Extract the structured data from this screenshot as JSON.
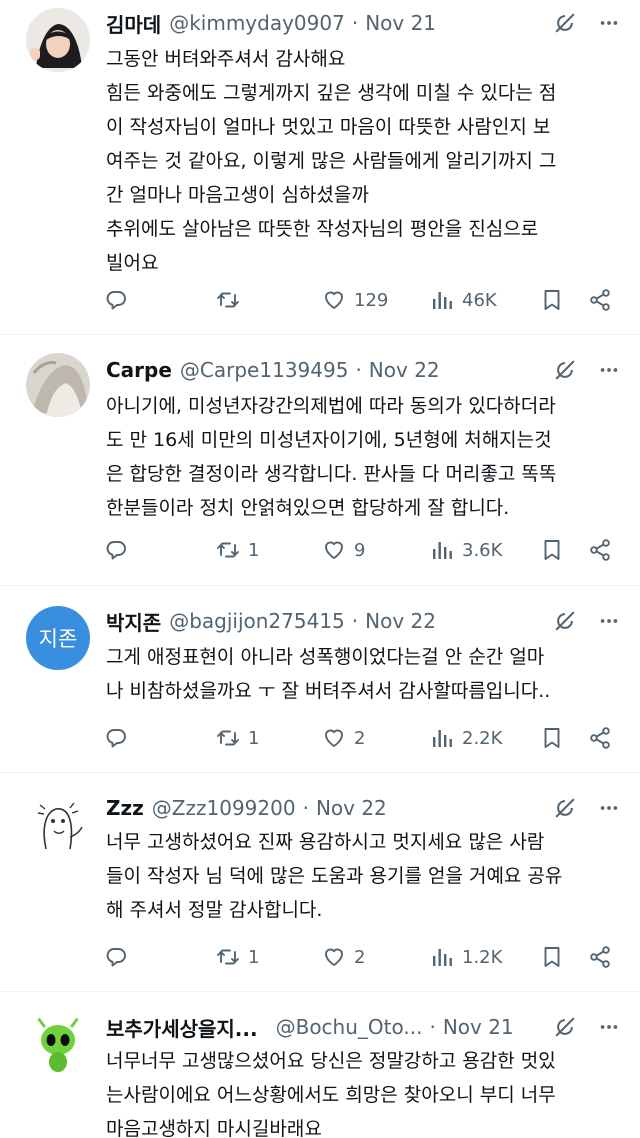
{
  "tweets": [
    {
      "name": "김마데",
      "handle": "@kimmyday0907",
      "date": "Nov 21",
      "lines": [
        "그동안 버텨와주셔서 감사해요",
        "힘든 와중에도 그렇게까지 깊은 생각에 미칠 수 있다는 점",
        "이 작성자님이 얼마나 멋있고 마음이 따뜻한 사람인지 보",
        "여주는 것 같아요, 이렇게 많은 사람들에게 알리기까지 그",
        "간 얼마나 마음고생이 심하셨을까",
        "추위에도 살아남은 따뜻한 작성자님의 평안을 진심으로",
        "빌어요"
      ],
      "replies": "",
      "retweets": "",
      "likes": "129",
      "views": "46K"
    },
    {
      "name": "Carpe",
      "handle": "@Carpe1139495",
      "date": "Nov 22",
      "lines": [
        "아니기에, 미성년자강간의제법에 따라 동의가 있다하더라",
        "도 만 16세 미만의 미성년자이기에, 5년형에 처해지는것",
        "은 합당한 결정이라 생각합니다. 판사들 다 머리좋고 똑똑",
        "한분들이라 정치 안얽혀있으면 합당하게 잘 합니다."
      ],
      "replies": "",
      "retweets": "1",
      "likes": "9",
      "views": "3.6K"
    },
    {
      "name": "박지존",
      "handle": "@bagjijon275415",
      "date": "Nov 22",
      "avatar_text": "지존",
      "lines": [
        "그게 애정표현이 아니라 성폭행이었다는걸 안 순간 얼마",
        "나 비참하셨을까요 ㅜ 잘 버텨주셔서 감사할따름입니다.."
      ],
      "replies": "",
      "retweets": "1",
      "likes": "2",
      "views": "2.2K"
    },
    {
      "name": "Zzz",
      "handle": "@Zzz1099200",
      "date": "Nov 22",
      "lines": [
        "너무 고생하셨어요 진짜 용감하시고 멋지세요 많은 사람",
        "들이 작성자 님 덕에 많은 도움과 용기를 얻을 거예요 공유",
        "해 주셔서 정말 감사합니다."
      ],
      "replies": "",
      "retweets": "1",
      "likes": "2",
      "views": "1.2K"
    },
    {
      "name": "보추가세상을지...",
      "handle": "@Bochu_Oto...",
      "date": "Nov 21",
      "lines": [
        "너무너무 고생많으셨어요 당신은 정말강하고 용감한 멋있",
        "는사람이에요 어느상황에서도 희망은 찾아오니 부디 너무",
        "마음고생하지 마시길바래요"
      ]
    }
  ],
  "colors": {
    "text": "#0f1419",
    "secondary": "#536471",
    "divider": "#eff3f4",
    "avatar_blue": "#3a8ee0"
  },
  "icons": [
    "grok-icon",
    "more-icon",
    "reply-icon",
    "retweet-icon",
    "like-icon",
    "views-icon",
    "bookmark-icon",
    "share-icon"
  ]
}
